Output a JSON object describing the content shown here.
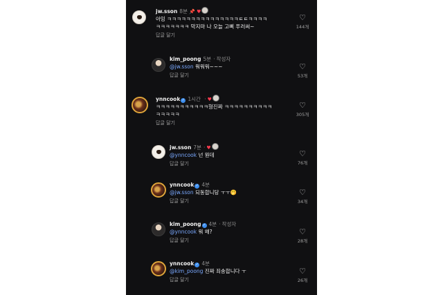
{
  "reply_label": "답글 달기",
  "author_label": "작성자",
  "comments": [
    {
      "username": "jw.sson",
      "time": "8분",
      "lines": [
        "아잉 ㅋㅋㅋㅋㅋㅋㅋㅋㅋㅋㅋㅋㅋㅋㅋㅌㅌㅋㅋㅋㅋ",
        "ㅋㅋㅋㅋㅋㅋㅋ 막지마 나 오늘 고삐 푸러써~"
      ],
      "likes": "144개"
    },
    {
      "username": "kim_poong",
      "time": "5분",
      "mention": "@jw.sson",
      "text": " 워워워~~~",
      "likes": "53개"
    },
    {
      "username": "ynncook",
      "time": "1시간",
      "lines": [
        "ㅋㅋㅋㅋㅋㅋㅋㅋㅋㅋㅋ형진짜 ㅋㅋㅋㅋㅋㅋㅋㅋㅋㅋ",
        "ㅋㅋㅋㅋㅋ"
      ],
      "likes": "305개"
    },
    {
      "username": "jw.sson",
      "time": "7분",
      "mention": "@ynncook",
      "text": " 넌 뭔데",
      "likes": "76개"
    },
    {
      "username": "ynncook",
      "time": "4분",
      "mention": "@jw.sson",
      "text": " 되동합니당 ㅜㅜ🤭",
      "likes": "34개"
    },
    {
      "username": "kim_poong",
      "time": "4분",
      "mention": "@ynncook",
      "text": " 워 왜?",
      "likes": "28개"
    },
    {
      "username": "ynncook",
      "time": "4분",
      "mention": "@kim_poong",
      "text": " 진짜 죄송합니다 ㅜ",
      "likes": "26개"
    }
  ]
}
